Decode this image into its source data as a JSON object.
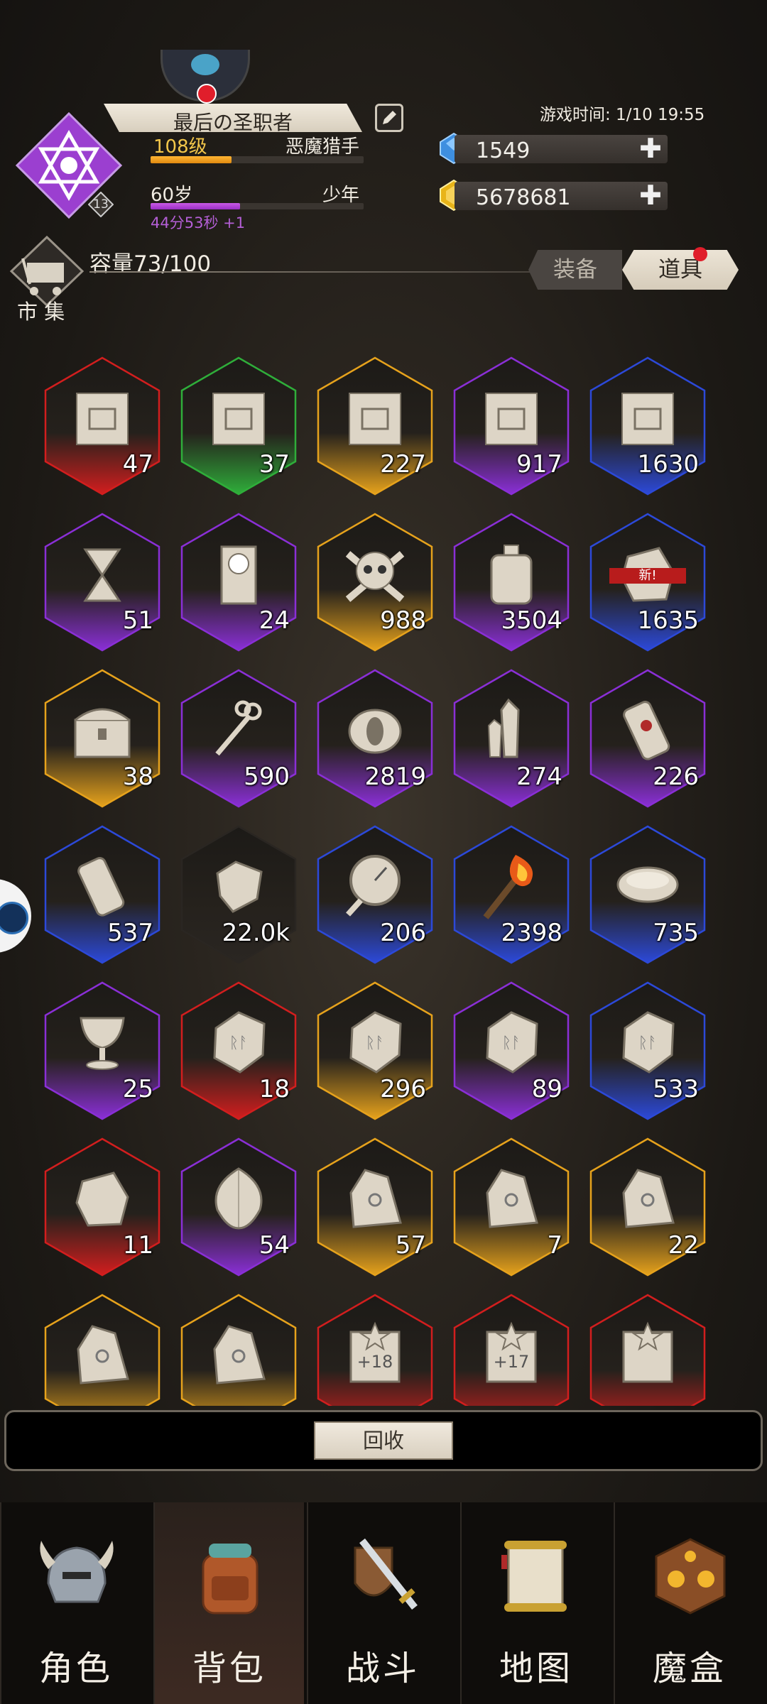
{
  "profile": {
    "name": "最后の圣职者",
    "level": "108级",
    "class": "恶魔猎手",
    "level_progress": 0.38,
    "age": "60岁",
    "stage": "少年",
    "age_progress": 0.42,
    "timer": "44分53秒 +1",
    "badge_level": "13"
  },
  "game_time": "游戏时间: 1/10 19:55",
  "resources": {
    "gems": "1549",
    "gold": "5678681",
    "plus": "✚"
  },
  "inventory": {
    "market_label": "市 集",
    "capacity": "容量73/100",
    "tab_equipment": "装备",
    "tab_items": "道具"
  },
  "colors": {
    "red": "#d21e1e",
    "green": "#2fae3a",
    "gold": "#e6a21c",
    "purple": "#8a2fd6",
    "blue": "#2c49d8",
    "dark": "#2a2622"
  },
  "items": [
    {
      "icon": "map-chest-icon",
      "rarity": "red",
      "qty": "47"
    },
    {
      "icon": "map-chest-icon",
      "rarity": "green",
      "qty": "37"
    },
    {
      "icon": "map-chest-icon",
      "rarity": "gold",
      "qty": "227"
    },
    {
      "icon": "map-chest-icon",
      "rarity": "purple",
      "qty": "917"
    },
    {
      "icon": "map-chest-icon",
      "rarity": "blue",
      "qty": "1630"
    },
    {
      "icon": "hourglass-icon",
      "rarity": "purple",
      "qty": "51"
    },
    {
      "icon": "clock-icon",
      "rarity": "purple",
      "qty": "24"
    },
    {
      "icon": "skull-icon",
      "rarity": "gold",
      "qty": "988"
    },
    {
      "icon": "jar-icon",
      "rarity": "purple",
      "qty": "3504"
    },
    {
      "icon": "stone-icon",
      "rarity": "blue",
      "qty": "1635",
      "badge": "新!"
    },
    {
      "icon": "treasure-chest-icon",
      "rarity": "gold",
      "qty": "38"
    },
    {
      "icon": "keys-icon",
      "rarity": "purple",
      "qty": "590"
    },
    {
      "icon": "eye-stone-icon",
      "rarity": "purple",
      "qty": "2819"
    },
    {
      "icon": "crystal-icon",
      "rarity": "purple",
      "qty": "274"
    },
    {
      "icon": "sealed-scroll-icon",
      "rarity": "purple",
      "qty": "226"
    },
    {
      "icon": "scroll-icon",
      "rarity": "blue",
      "qty": "537"
    },
    {
      "icon": "cloth-icon",
      "rarity": "dark",
      "qty": "22.0k"
    },
    {
      "icon": "compass-icon",
      "rarity": "blue",
      "qty": "206"
    },
    {
      "icon": "torch-icon",
      "rarity": "blue",
      "qty": "2398"
    },
    {
      "icon": "bowl-icon",
      "rarity": "blue",
      "qty": "735"
    },
    {
      "icon": "chalice-icon",
      "rarity": "purple",
      "qty": "25"
    },
    {
      "icon": "rune-tablet-icon",
      "rarity": "red",
      "qty": "18"
    },
    {
      "icon": "rune-tablet-icon",
      "rarity": "gold",
      "qty": "296"
    },
    {
      "icon": "rune-tablet-icon",
      "rarity": "purple",
      "qty": "89"
    },
    {
      "icon": "rune-tablet-icon",
      "rarity": "blue",
      "qty": "533"
    },
    {
      "icon": "ribbon-stone-icon",
      "rarity": "red",
      "qty": "11"
    },
    {
      "icon": "gem-stone-icon",
      "rarity": "purple",
      "qty": "54"
    },
    {
      "icon": "rune-shard-icon",
      "rarity": "gold",
      "qty": "57"
    },
    {
      "icon": "rune-shard-icon",
      "rarity": "gold",
      "qty": "7"
    },
    {
      "icon": "rune-shard-icon",
      "rarity": "gold",
      "qty": "22"
    },
    {
      "icon": "rune-shard-icon",
      "rarity": "gold",
      "qty": ""
    },
    {
      "icon": "rune-shard-icon",
      "rarity": "gold",
      "qty": ""
    },
    {
      "icon": "enhance-scroll-icon",
      "rarity": "red",
      "qty": "",
      "mark": "+18"
    },
    {
      "icon": "enhance-scroll-icon",
      "rarity": "red",
      "qty": "",
      "mark": "+17"
    },
    {
      "icon": "enhance-scroll-icon",
      "rarity": "red",
      "qty": ""
    }
  ],
  "recycle_label": "回收",
  "nav": [
    {
      "label": "角色",
      "icon": "helmet-icon"
    },
    {
      "label": "背包",
      "icon": "backpack-icon",
      "active": true
    },
    {
      "label": "战斗",
      "icon": "sword-shield-icon"
    },
    {
      "label": "地图",
      "icon": "map-scroll-icon"
    },
    {
      "label": "魔盒",
      "icon": "magic-cube-icon"
    }
  ]
}
